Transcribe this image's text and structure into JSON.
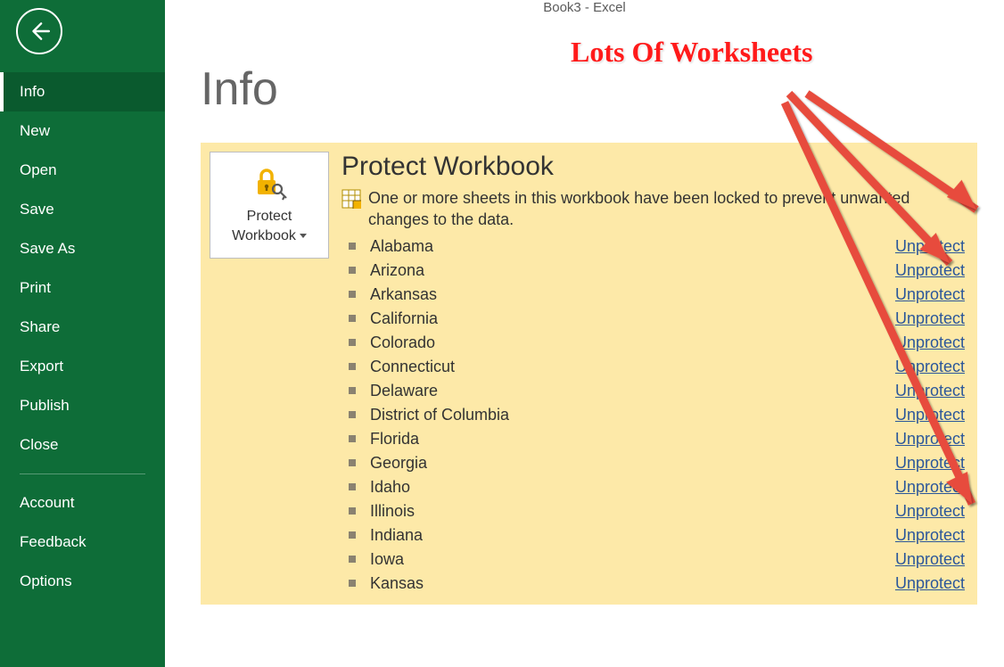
{
  "window_title": "Book3 - Excel",
  "page_title": "Info",
  "sidebar": {
    "items": [
      {
        "label": "Info",
        "active": true
      },
      {
        "label": "New"
      },
      {
        "label": "Open"
      },
      {
        "label": "Save"
      },
      {
        "label": "Save As"
      },
      {
        "label": "Print"
      },
      {
        "label": "Share"
      },
      {
        "label": "Export"
      },
      {
        "label": "Publish"
      },
      {
        "label": "Close"
      }
    ],
    "bottom_items": [
      {
        "label": "Account"
      },
      {
        "label": "Feedback"
      },
      {
        "label": "Options"
      }
    ]
  },
  "protect": {
    "button_label_line1": "Protect",
    "button_label_line2": "Workbook",
    "heading": "Protect Workbook",
    "description": "One or more sheets in this workbook have been locked to prevent unwanted changes to the data.",
    "unprotect_label": "Unprotect",
    "sheets": [
      "Alabama",
      "Arizona",
      "Arkansas",
      "California",
      "Colorado",
      "Connecticut",
      "Delaware",
      "District of Columbia",
      "Florida",
      "Georgia",
      "Idaho",
      "Illinois",
      "Indiana",
      "Iowa",
      "Kansas"
    ]
  },
  "annotation_text": "Lots Of Worksheets"
}
